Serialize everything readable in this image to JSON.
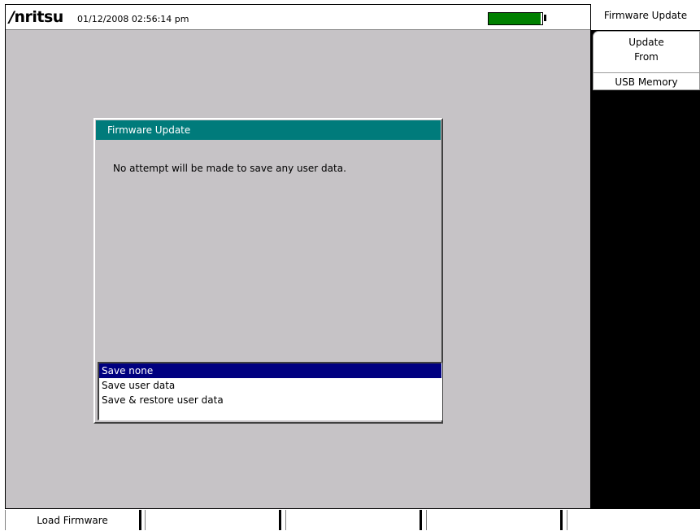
{
  "header": {
    "brand": "/inritsu",
    "datetime": "01/12/2008 02:56:14 pm",
    "battery_level": 0.97,
    "battery_color": "#008000"
  },
  "side_menu": {
    "title": "Firmware Update",
    "key": {
      "line1": "Update",
      "line2": "From",
      "line3": "USB Memory"
    }
  },
  "dialog": {
    "title": "Firmware Update",
    "message": "No attempt will be made to save any user data.",
    "options": [
      "Save none",
      "Save user data",
      "Save & restore user data"
    ],
    "selected_index": 0,
    "title_color": "#007b7b",
    "selection_color": "#000080"
  },
  "bottom_keys": [
    "Load Firmware",
    "",
    "",
    "",
    ""
  ]
}
